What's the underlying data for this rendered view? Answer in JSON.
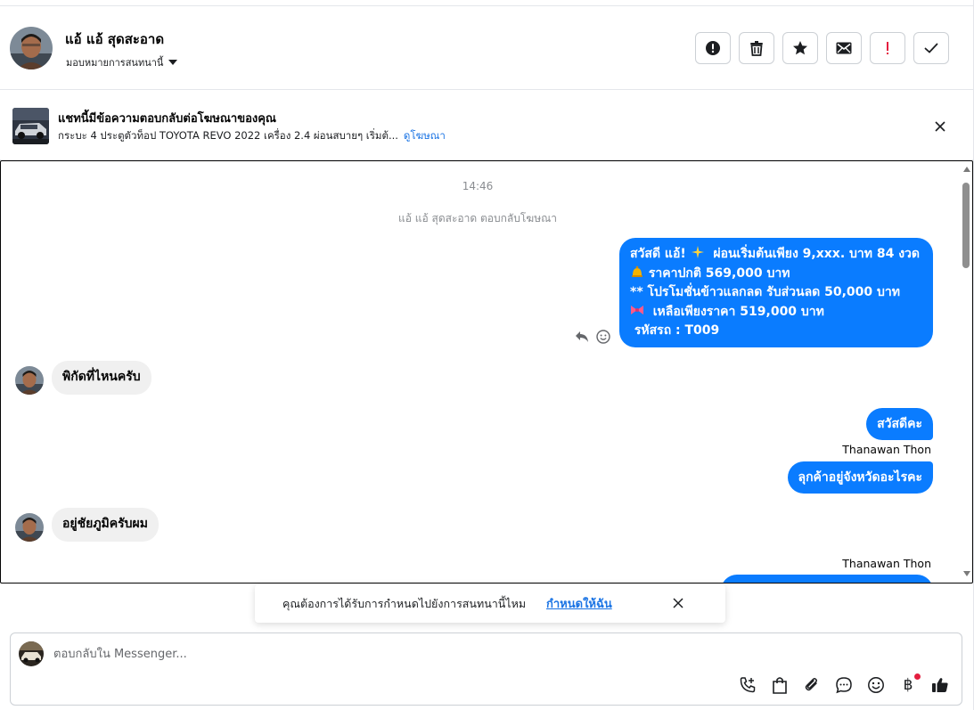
{
  "header": {
    "contact_name": "แอ้ แอ้ สุดสะอาด",
    "assign_label": "มอบหมายการสนทนานี้",
    "actions": [
      {
        "name": "report-spam-button",
        "icon": "alert-circle-icon"
      },
      {
        "name": "delete-button",
        "icon": "trash-icon"
      },
      {
        "name": "star-button",
        "icon": "star-icon"
      },
      {
        "name": "mark-unread-button",
        "icon": "envelope-icon"
      },
      {
        "name": "follow-up-button",
        "icon": "exclamation-icon"
      },
      {
        "name": "mark-done-button",
        "icon": "check-icon"
      }
    ]
  },
  "ad_banner": {
    "title": "แชทนี้มีข้อความตอบกลับต่อโฆษณาของคุณ",
    "subtitle": "กระบะ 4 ประตูตัวท็อป TOYOTA REVO 2022 เครื่อง 2.4 ผ่อนสบายๆ เริ่มต้...",
    "link_label": "ดูโฆษณา"
  },
  "chat": {
    "timestamp": "14:46",
    "reply_note": "แอ้ แอ้ สุดสะอาด ตอบกลับโฆษณา",
    "messages": {
      "promo": {
        "line1_a": "สวัสดี แอ้!",
        "line1_b": "ผ่อนเริ่มต้นเพียง 9,xxx. บาท 84 งวด",
        "line2": "ราคาปกติ 569,000 บาท",
        "line3": "** โปรโมชั่นข้าวแลกลด รับส่วนลด 50,000 บาท",
        "line4": "เหลือเพียงราคา 519,000 บาท",
        "line5": "รหัสรถ : T009"
      },
      "in1": "พิกัดที่ไหนครับ",
      "out2": "สวัสดีคะ",
      "sender1": "Thanawan Thon",
      "out3": "ลุกค้าอยู่จังหวัดอะไรคะ",
      "in2": "อยู่ชัยภูมิครับผม",
      "sender2": "Thanawan Thon"
    }
  },
  "toast": {
    "text": "คุณต้องการได้รับการกำหนดไปยังการสนทนานี้ไหม",
    "link_label": "กำหนดให้ฉัน"
  },
  "composer": {
    "placeholder": "ตอบกลับใน Messenger...",
    "tools": [
      "call-add-icon",
      "shopping-bag-icon",
      "paperclip-icon",
      "saved-reply-icon",
      "emoji-icon",
      "baht-payment-icon",
      "like-icon"
    ]
  },
  "colors": {
    "accent": "#0a7cff",
    "link": "#1b74e4",
    "incoming_bubble": "#f0f0f0"
  }
}
